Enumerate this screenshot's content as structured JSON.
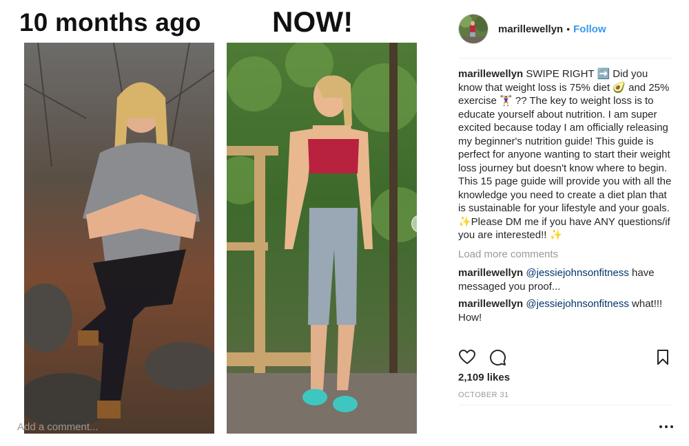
{
  "post_image": {
    "caption_before": "10 months ago",
    "caption_after": "NOW!",
    "next_icon": "chevron-right-icon"
  },
  "header": {
    "username": "marillewellyn",
    "separator": "•",
    "follow_label": "Follow"
  },
  "comments": [
    {
      "username": "marillewellyn",
      "text": "SWIPE RIGHT ➡️ Did you know that weight loss is 75% diet 🥑 and 25% exercise 🏋️‍♀️ ?? The key to weight loss is to educate yourself about nutrition. I am super excited because today I am officially releasing my beginner's nutrition guide! This guide is perfect for anyone wanting to start their weight loss journey but doesn't know where to begin. This 15 page guide will provide you with all the knowledge you need to create a diet plan that is sustainable for your lifestyle and your goals. ✨Please DM me if you have ANY questions/if you are interested!! ✨"
    }
  ],
  "load_more_label": "Load more comments",
  "replies": [
    {
      "username": "marillewellyn",
      "mention": "@jessiejohnsonfitness",
      "text": " have messaged you proof..."
    },
    {
      "username": "marillewellyn",
      "mention": "@jessiejohnsonfitness",
      "text": " what!!! How!"
    }
  ],
  "actions": {
    "like_icon": "heart-icon",
    "comment_icon": "comment-bubble-icon",
    "save_icon": "bookmark-icon"
  },
  "likes": "2,109 likes",
  "date": "OCTOBER 31",
  "add_comment": {
    "placeholder": "Add a comment..."
  },
  "more_icon": "ellipsis-icon",
  "colors": {
    "link_blue": "#3897f0",
    "mention_blue": "#003569",
    "muted": "#999999",
    "text": "#262626",
    "divider": "#efefef"
  }
}
